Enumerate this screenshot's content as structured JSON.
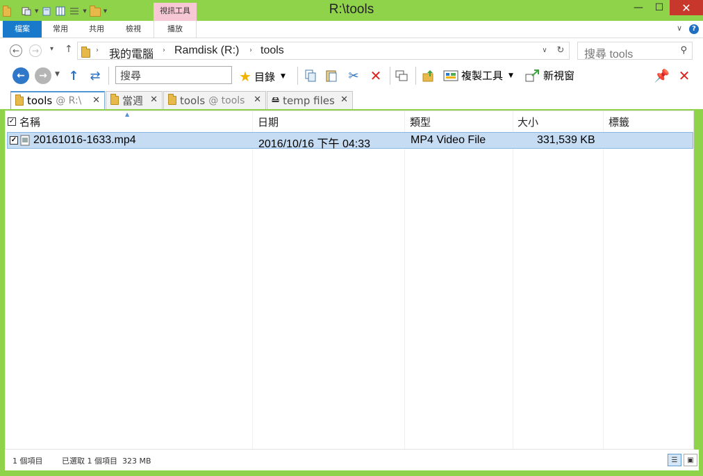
{
  "window": {
    "title": "R:\\tools",
    "context_tab_group": "視訊工具"
  },
  "ribbon": {
    "tabs": [
      "檔案",
      "常用",
      "共用",
      "檢視",
      "播放"
    ]
  },
  "address": {
    "crumbs": [
      "我的電腦",
      "Ramdisk (R:)",
      "tools"
    ],
    "search_placeholder": "搜尋 tools"
  },
  "toolbar": {
    "search_placeholder": "搜尋",
    "bookmarks_label": "目錄",
    "copy_tools_label": "複製工具",
    "new_window_label": "新視窗"
  },
  "folder_tabs": [
    {
      "name": "tools",
      "location": "@ R:\\",
      "active": true
    },
    {
      "name": "當週",
      "location": "",
      "active": false
    },
    {
      "name": "tools",
      "location": "@ tools",
      "active": false
    },
    {
      "name": "temp files",
      "location": "",
      "active": false
    }
  ],
  "columns": [
    "名稱",
    "日期",
    "類型",
    "大小",
    "標籤"
  ],
  "files": [
    {
      "name": "20161016-1633.mp4",
      "date": "2016/10/16 下午 04:33",
      "type": "MP4 Video File",
      "size": "331,539 KB",
      "tag": "",
      "checked": true,
      "selected": true
    }
  ],
  "status": {
    "item_count": "1 個項目",
    "selection": "已選取 1 個項目  323 MB"
  },
  "colors": {
    "frame": "#8fd34a",
    "file_tab": "#1979ca",
    "context_tab": "#f7c7d6",
    "selection": "#c5dcf3",
    "close_button": "#c7372c"
  }
}
